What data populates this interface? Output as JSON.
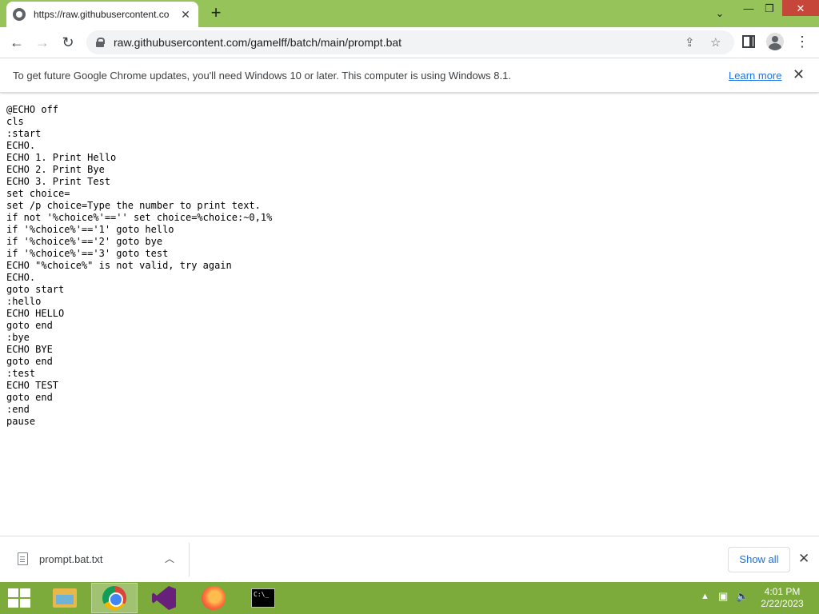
{
  "browser": {
    "tab_title": "https://raw.githubusercontent.co",
    "tab_close": "✕",
    "new_tab": "+",
    "url": "raw.githubusercontent.com/gamelff/batch/main/prompt.bat"
  },
  "infobar": {
    "message": "To get future Google Chrome updates, you'll need Windows 10 or later. This computer is using Windows 8.1.",
    "link": "Learn more",
    "close": "✕"
  },
  "file_content": {
    "lines": [
      "@ECHO off",
      "cls",
      ":start",
      "ECHO.",
      "ECHO 1. Print Hello",
      "ECHO 2. Print Bye",
      "ECHO 3. Print Test",
      "set choice=",
      "set /p choice=Type the number to print text.",
      "if not '%choice%'=='' set choice=%choice:~0,1%",
      "if '%choice%'=='1' goto hello",
      "if '%choice%'=='2' goto bye",
      "if '%choice%'=='3' goto test",
      "ECHO \"%choice%\" is not valid, try again",
      "ECHO.",
      "goto start",
      ":hello",
      "ECHO HELLO",
      "goto end",
      ":bye",
      "ECHO BYE",
      "goto end",
      ":test",
      "ECHO TEST",
      "goto end",
      ":end",
      "pause"
    ]
  },
  "download_shelf": {
    "file_name": "prompt.bat.txt",
    "show_all": "Show all",
    "close": "✕"
  },
  "taskbar": {
    "apps": [
      "file-explorer",
      "google-chrome",
      "visual-studio",
      "firefox",
      "command-prompt"
    ],
    "active_app": "google-chrome",
    "clock_time": "4:01 PM",
    "clock_date": "2/22/2023"
  },
  "colors": {
    "titlebar": "#97c45a",
    "taskbar": "#7cab3b",
    "link": "#1a73e8"
  }
}
